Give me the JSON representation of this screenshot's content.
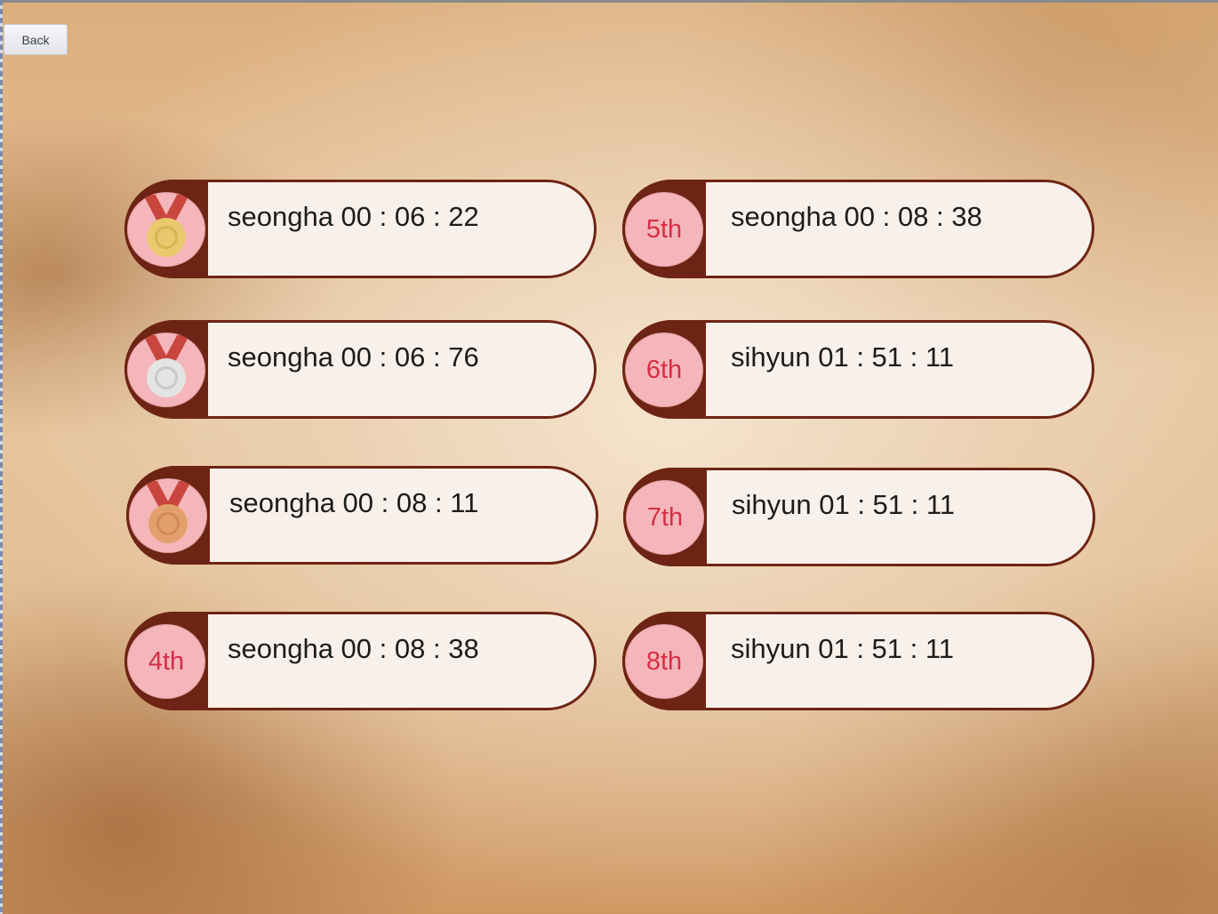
{
  "toolbar": {
    "back_label": "Back"
  },
  "colors": {
    "card_border": "#6e2414",
    "card_fill": "#f8f0ea",
    "badge_fill": "#f4b6ba",
    "rank_text": "#d32f45",
    "ribbon": "#c9463f",
    "gold": "#e9c96e",
    "silver": "#dcdcdc",
    "bronze": "#e3a06c"
  },
  "leaderboard": {
    "left": [
      {
        "badge_type": "medal",
        "medal": "gold-medal-icon",
        "rank": "",
        "text": "seongha 00 : 06 : 22"
      },
      {
        "badge_type": "medal",
        "medal": "silver-medal-icon",
        "rank": "",
        "text": "seongha 00 : 06 : 76"
      },
      {
        "badge_type": "medal",
        "medal": "bronze-medal-icon",
        "rank": "",
        "text": "seongha 00 : 08 : 11"
      },
      {
        "badge_type": "rank",
        "medal": "",
        "rank": "4th",
        "text": "seongha 00 : 08 : 38"
      }
    ],
    "right": [
      {
        "badge_type": "rank",
        "medal": "",
        "rank": "5th",
        "text": "seongha 00 : 08 : 38"
      },
      {
        "badge_type": "rank",
        "medal": "",
        "rank": "6th",
        "text": "sihyun 01 : 51 : 11"
      },
      {
        "badge_type": "rank",
        "medal": "",
        "rank": "7th",
        "text": "sihyun 01 : 51 : 11"
      },
      {
        "badge_type": "rank",
        "medal": "",
        "rank": "8th",
        "text": "sihyun 01 : 51 : 11"
      }
    ]
  }
}
